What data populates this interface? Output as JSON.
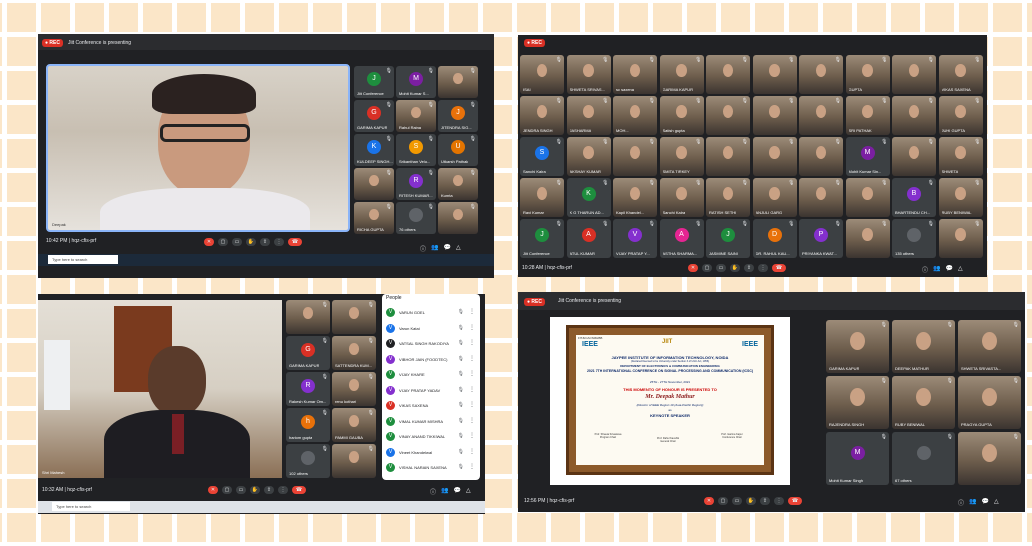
{
  "q1": {
    "rec": "REC",
    "presenting": "Jiit Conference is presenting",
    "time": "10:42 PM",
    "meeting": "hqz-cfis-prf",
    "tiles": [
      {
        "name": "Jiit Conference",
        "initial": "J",
        "color": "#1e8e3e"
      },
      {
        "name": "Mohit Kumar S...",
        "initial": "M",
        "color": "#7b1fa2"
      },
      {
        "name": "",
        "initial": "",
        "color": "",
        "cam": true
      },
      {
        "name": "GARIMA KAPUR",
        "initial": "G",
        "color": "#d93025"
      },
      {
        "name": "Rahul Raina",
        "initial": "",
        "color": "",
        "cam": true
      },
      {
        "name": "JITENDRA SIG...",
        "initial": "J",
        "color": "#e8710a"
      },
      {
        "name": "KULDEEP SINGH...",
        "initial": "K",
        "color": "#1a73e8"
      },
      {
        "name": "Srikanthan Velu...",
        "initial": "S",
        "color": "#f29900"
      },
      {
        "name": "Utkarsh Pathak",
        "initial": "U",
        "color": "#e37400"
      },
      {
        "name": "",
        "initial": "",
        "color": "",
        "cam": true
      },
      {
        "name": "RITESH KUMAR...",
        "initial": "R",
        "color": "#8430ce"
      },
      {
        "name": "Kumta",
        "initial": "",
        "color": "",
        "cam": true
      },
      {
        "name": "RICHA GUPTA",
        "initial": "",
        "color": "",
        "cam": true
      },
      {
        "name": "76 others",
        "initial": "",
        "color": "#5f6368"
      },
      {
        "name": "",
        "initial": "",
        "color": "",
        "cam": true
      }
    ],
    "search": "Type here to search",
    "speaker": "Deepak"
  },
  "q2": {
    "rec": "REC",
    "time": "10:28 AM",
    "meeting": "hqz-cfis-prf",
    "tiles": [
      {
        "name": "ISAI",
        "cam": true
      },
      {
        "name": "SHWETA SRIVAS...",
        "cam": true
      },
      {
        "name": "sc saxena",
        "cam": true
      },
      {
        "name": "GARIMA KAPUR",
        "cam": true
      },
      {
        "name": "",
        "cam": true
      },
      {
        "name": "",
        "cam": true
      },
      {
        "name": "",
        "cam": true
      },
      {
        "name": "GUPTA",
        "cam": true
      },
      {
        "name": "",
        "cam": true
      },
      {
        "name": "VIKAS SAXENA",
        "cam": true
      },
      {
        "name": "JENDRA SINGH",
        "cam": true
      },
      {
        "name": "JASHARMA",
        "cam": true
      },
      {
        "name": "MOH...",
        "cam": true
      },
      {
        "name": "Satish gupta",
        "cam": true
      },
      {
        "name": "",
        "cam": true
      },
      {
        "name": "",
        "cam": true
      },
      {
        "name": "",
        "cam": true
      },
      {
        "name": "SRI PATHAK",
        "cam": true
      },
      {
        "name": "",
        "cam": true
      },
      {
        "name": "JUHI GUPTA",
        "cam": true
      },
      {
        "name": "Sanchi Kalra",
        "initial": "S",
        "color": "#1a73e8"
      },
      {
        "name": "AKSHAY KUMAR",
        "cam": true
      },
      {
        "name": "",
        "cam": true
      },
      {
        "name": "SMITA TIRKEY",
        "cam": true
      },
      {
        "name": "",
        "cam": true
      },
      {
        "name": "",
        "cam": true
      },
      {
        "name": "",
        "cam": true
      },
      {
        "name": "Mohit Kumar Sin...",
        "initial": "M",
        "color": "#7b1fa2"
      },
      {
        "name": "",
        "cam": true
      },
      {
        "name": "SHWETA",
        "cam": true
      },
      {
        "name": "Ravi Kumar",
        "cam": true
      },
      {
        "name": "K G THARUN AD...",
        "initial": "K",
        "color": "#1e8e3e"
      },
      {
        "name": "Kapil Khandel...",
        "cam": true
      },
      {
        "name": "Sanchi Kalra",
        "cam": true
      },
      {
        "name": "RATISH SETHI",
        "cam": true
      },
      {
        "name": "ANJULI GARG",
        "cam": true
      },
      {
        "name": "",
        "cam": true
      },
      {
        "name": "",
        "cam": true
      },
      {
        "name": "BHARTENDU CH...",
        "initial": "B",
        "color": "#8430ce"
      },
      {
        "name": "RUBY BENIWAL",
        "cam": true
      },
      {
        "name": "Jiit Conference",
        "initial": "J",
        "color": "#1e8e3e"
      },
      {
        "name": "ATUL KUMAR",
        "initial": "A",
        "color": "#d93025"
      },
      {
        "name": "VIJAY PRATAP Y...",
        "initial": "V",
        "color": "#8430ce"
      },
      {
        "name": "ASTHA SHARMA...",
        "initial": "A",
        "color": "#e52592"
      },
      {
        "name": "JASMINE SAINI",
        "initial": "J",
        "color": "#1e8e3e"
      },
      {
        "name": "DR. RAHUL KAU...",
        "initial": "D",
        "color": "#e8710a"
      },
      {
        "name": "PRIYANKA KWAT...",
        "initial": "P",
        "color": "#8430ce"
      },
      {
        "name": "",
        "cam": true
      },
      {
        "name": "135 others",
        "color": "#5f6368"
      },
      {
        "name": "",
        "cam": true
      }
    ]
  },
  "q3": {
    "time": "10:32 AM",
    "meeting": "hqz-cfis-prf",
    "people_title": "People",
    "search": "Type here to search",
    "speaker": "Shri Mahesh",
    "tiles": [
      {
        "name": "",
        "cam": true
      },
      {
        "name": "",
        "cam": true
      },
      {
        "name": "GARIMA KAPUR",
        "initial": "G",
        "color": "#d93025"
      },
      {
        "name": "SATTENDRA KUM...",
        "cam": true
      },
      {
        "name": "Rakesh Kumar Om...",
        "initial": "R",
        "color": "#8430ce"
      },
      {
        "name": "renu kothari",
        "cam": true
      },
      {
        "name": "hariom gupta",
        "initial": "h",
        "color": "#e8710a"
      },
      {
        "name": "PAMMI GAUBA",
        "cam": true
      },
      {
        "name": "102 others",
        "color": "#5f6368"
      },
      {
        "name": "",
        "cam": true
      }
    ],
    "people": [
      {
        "name": "VARUN GOEL",
        "initial": "V",
        "color": "#1e8e3e"
      },
      {
        "name": "Varun Katai",
        "initial": "V",
        "color": "#1a73e8"
      },
      {
        "name": "VATSAL SINGH RAKODIYA",
        "initial": "V",
        "color": "#202124"
      },
      {
        "name": "VIBHOR JAIN (FOODTEC)",
        "initial": "V",
        "color": "#8430ce"
      },
      {
        "name": "VIJAY KHARE",
        "initial": "V",
        "color": "#1e8e3e"
      },
      {
        "name": "VIJAY PRATAP YADAV",
        "initial": "V",
        "color": "#8430ce"
      },
      {
        "name": "VIKAS SAXENA",
        "initial": "V",
        "color": "#d93025"
      },
      {
        "name": "VIMAL KUMAR MISHRA",
        "initial": "V",
        "color": "#1e8e3e"
      },
      {
        "name": "VINAY ANAND TIKKIWAL",
        "initial": "V",
        "color": "#1e8e3e"
      },
      {
        "name": "Vineet Khandelwal",
        "initial": "V",
        "color": "#1a73e8"
      },
      {
        "name": "VISHAL NARAIN SAXENA",
        "initial": "V",
        "color": "#1e8e3e"
      }
    ]
  },
  "q4": {
    "rec": "REC",
    "presenting": "Jiit Conference is presenting",
    "time": "12:56 PM",
    "meeting": "hqz-cfis-prf",
    "cert": {
      "tag": "FIT&ICACSMHBB",
      "inst": "JAYPEE INSTITUTE OF INFORMATION TECHNOLOGY, NOIDA",
      "sub": "(Declared Deemed to be University under Section 3 of UGC Act, 1956)",
      "dept": "DEPARTMENT OF ELECTRONICS & COMMUNICATION ENGINEERING",
      "conf": "2021 7TH INTERNATIONAL CONFERENCE ON SIGNAL PROCESSING AND COMMUNICATION (ICSC)",
      "dates": "25TH - 27TH November, 2021",
      "memento": "THIS MOMENTO OF HONOUR IS PRESENTED TO",
      "recipient": "Mr. Deepak Mathur",
      "role": "(Director of IEEE Region 10 (Asia-Pacific Region))",
      "as": "as",
      "keynote": "KEYNOTE SPEAKER",
      "logo1": "IEEE",
      "logo2": "IEEE",
      "jiit": "JIIT",
      "sig1": "Prof. Shweta Srivastava",
      "sig1r": "Program Chair",
      "sig2": "Prof. Rahul Kaushik",
      "sig2r": "General Chair",
      "sig3": "Prof. Garima Kapur",
      "sig3r": "Conference Chair"
    },
    "tiles": [
      {
        "name": "GARIMA KAPUR",
        "cam": true
      },
      {
        "name": "DEEPAK MATHUR",
        "cam": true
      },
      {
        "name": "SHWETA SRIVASTA...",
        "cam": true
      },
      {
        "name": "RAJENDRA SINGH",
        "cam": true
      },
      {
        "name": "RUBY BENIWAL",
        "cam": true
      },
      {
        "name": "PRAGYA GUPTA",
        "cam": true
      },
      {
        "name": "Mohit Kumar Singh",
        "initial": "M",
        "color": "#7b1fa2"
      },
      {
        "name": "67 others",
        "color": "#5f6368"
      },
      {
        "name": "",
        "cam": true
      }
    ]
  }
}
